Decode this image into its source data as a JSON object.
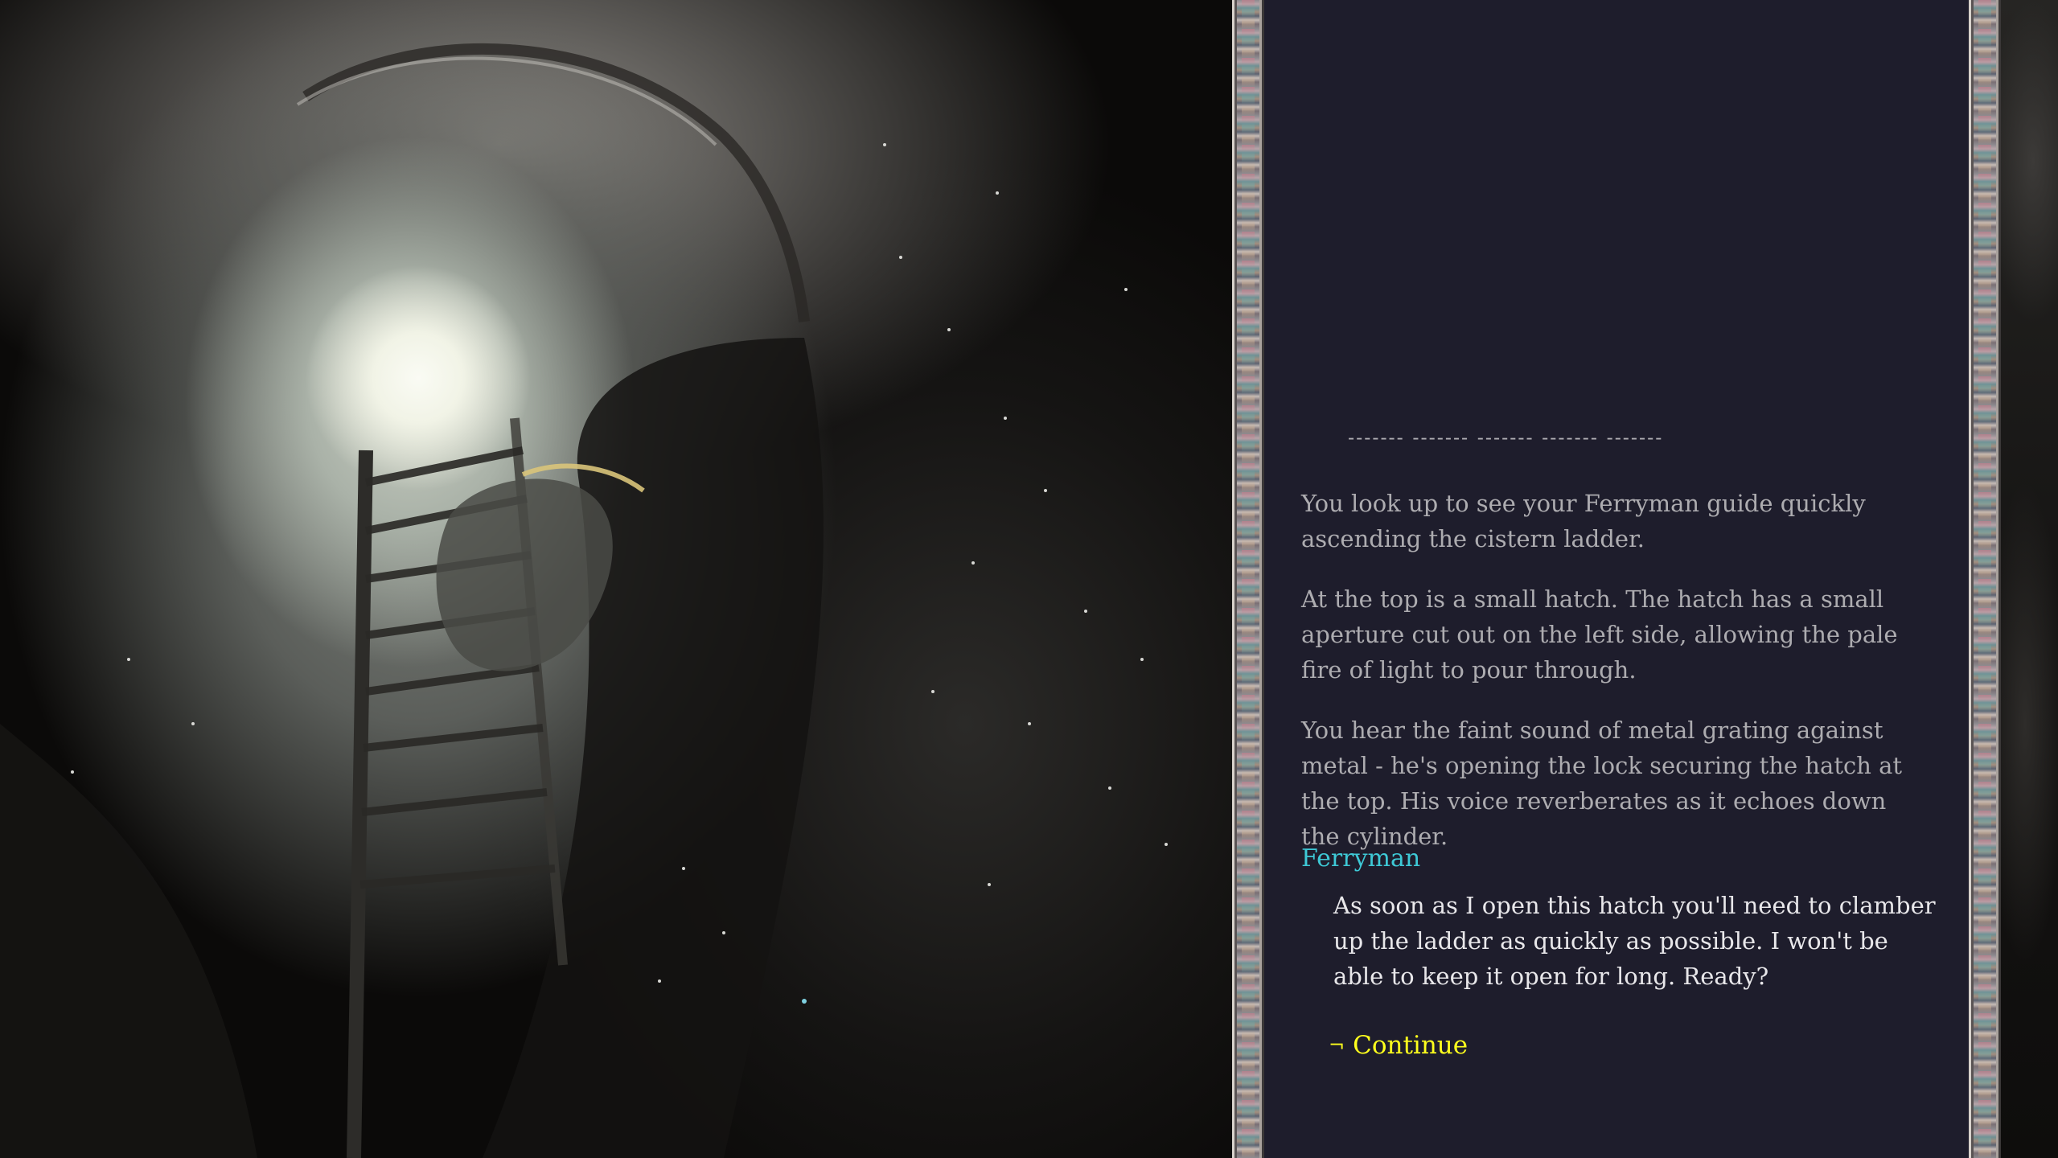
{
  "scene": {
    "image_name": "cistern-ladder-illustration",
    "description_icon": "cistern-ladder-scene"
  },
  "panel": {
    "divider": "------- ------- ------- ------- -------",
    "narration": [
      "You look up to see your Ferryman guide quickly ascending the cistern ladder.",
      "At the top is a small hatch.  The hatch has a small aperture cut out on the left side, allowing the pale fire of light to pour through.",
      "You hear the faint sound of metal grating against metal - he's opening the lock securing the hatch at the top.  His voice reverberates as it echoes down the cylinder."
    ],
    "speaker": "Ferryman",
    "dialogue": "As soon as I open this hatch you'll need to clamber up the ladder as quickly as possible.  I won't be able to keep it open for long.  Ready?",
    "choices": [
      {
        "arrow": "¬",
        "label": "Continue"
      }
    ]
  },
  "colors": {
    "panel_background": "#1e1d2c",
    "narration_text": "#adacb0",
    "speaker": "#3ec9d6",
    "dialogue_text": "#e8e7ea",
    "choice": "#ffff1d"
  }
}
